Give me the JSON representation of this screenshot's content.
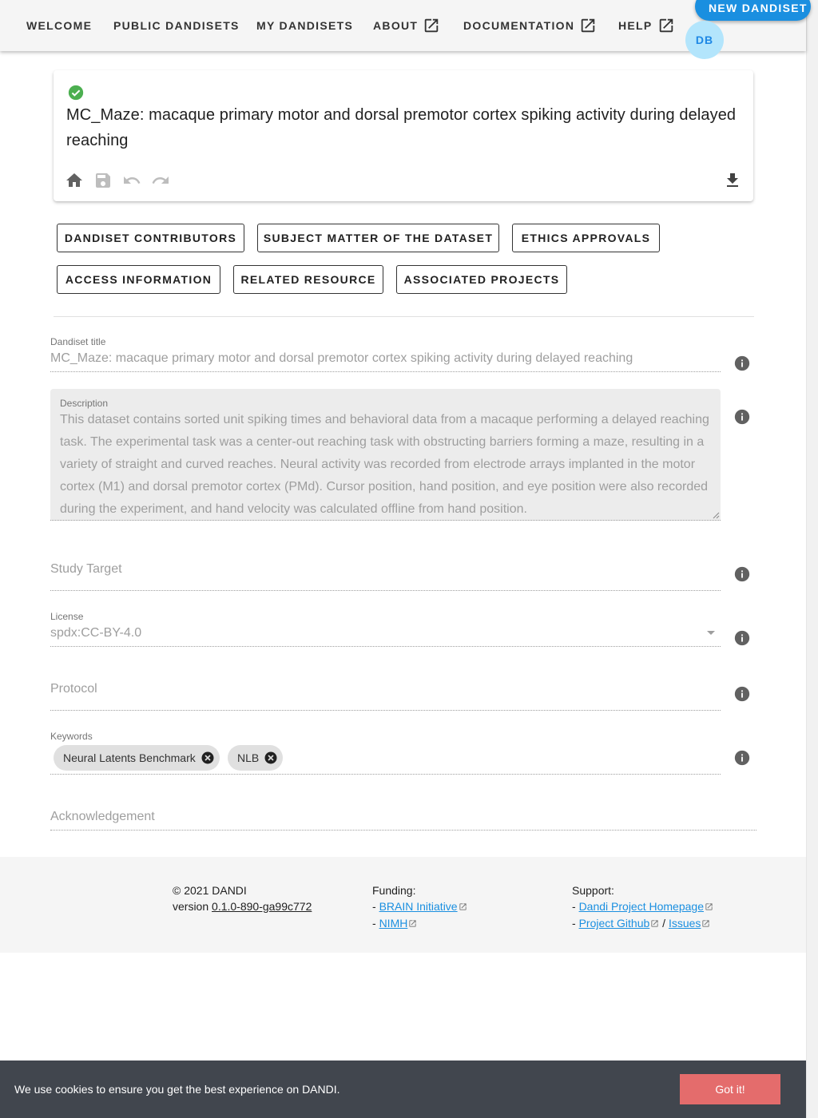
{
  "nav": {
    "items": [
      {
        "label": "Welcome"
      },
      {
        "label": "Public Dandisets"
      },
      {
        "label": "My Dandisets"
      },
      {
        "label": "About",
        "external": true
      },
      {
        "label": "Documentation",
        "external": true
      },
      {
        "label": "Help",
        "external": true
      }
    ],
    "new_dandiset_label": "New Dandiset",
    "avatar_initials": "DB"
  },
  "header": {
    "title": "MC_Maze: macaque primary motor and dorsal premotor cortex spiking activity during delayed reaching",
    "status_icon": "check-circle-icon",
    "toolbar_icons": [
      "home-icon",
      "save-icon",
      "undo-icon",
      "redo-icon"
    ],
    "download_icon": "download-icon"
  },
  "sections": {
    "buttons": [
      "Dandiset Contributors",
      "Subject Matter of the Dataset",
      "Ethics Approvals",
      "Access Information",
      "Related Resource",
      "Associated Projects"
    ]
  },
  "form": {
    "title": {
      "label": "Dandiset title",
      "value": "MC_Maze: macaque primary motor and dorsal premotor cortex spiking activity during delayed reaching"
    },
    "description": {
      "label": "Description",
      "value": "This dataset contains sorted unit spiking times and behavioral data from a macaque performing a delayed reaching task. The experimental task was a center-out reaching task with obstructing barriers forming a maze, resulting in a variety of straight and curved reaches. Neural activity was recorded from electrode arrays implanted in the motor cortex (M1) and dorsal premotor cortex (PMd). Cursor position, hand position, and eye position were also recorded during the experiment, and hand velocity was calculated offline from hand position."
    },
    "study_target": {
      "placeholder": "Study Target"
    },
    "license": {
      "label": "License",
      "value": "spdx:CC-BY-4.0"
    },
    "protocol": {
      "placeholder": "Protocol"
    },
    "keywords": {
      "label": "Keywords",
      "chips": [
        "Neural Latents Benchmark",
        "NLB"
      ]
    },
    "acknowledgement": {
      "placeholder": "Acknowledgement"
    }
  },
  "footer": {
    "copyright": "© 2021 DANDI",
    "version_prefix": "version ",
    "version": "0.1.0-890-ga99c772",
    "funding_title": "Funding:",
    "funding_links": [
      "BRAIN Initiative",
      "NIMH"
    ],
    "support_title": "Support:",
    "support_homepage": "Dandi Project Homepage",
    "support_github": "Project Github",
    "support_separator": "/",
    "support_issues": "Issues",
    "bullet": "- "
  },
  "cookie": {
    "message": "We use cookies to ensure you get the best experience on DANDI.",
    "button": "Got it!"
  },
  "colors": {
    "accent": "#1a8fe0",
    "success": "#4caf50",
    "cookie_bg": "#41464e",
    "cookie_button": "#e46c6c"
  }
}
